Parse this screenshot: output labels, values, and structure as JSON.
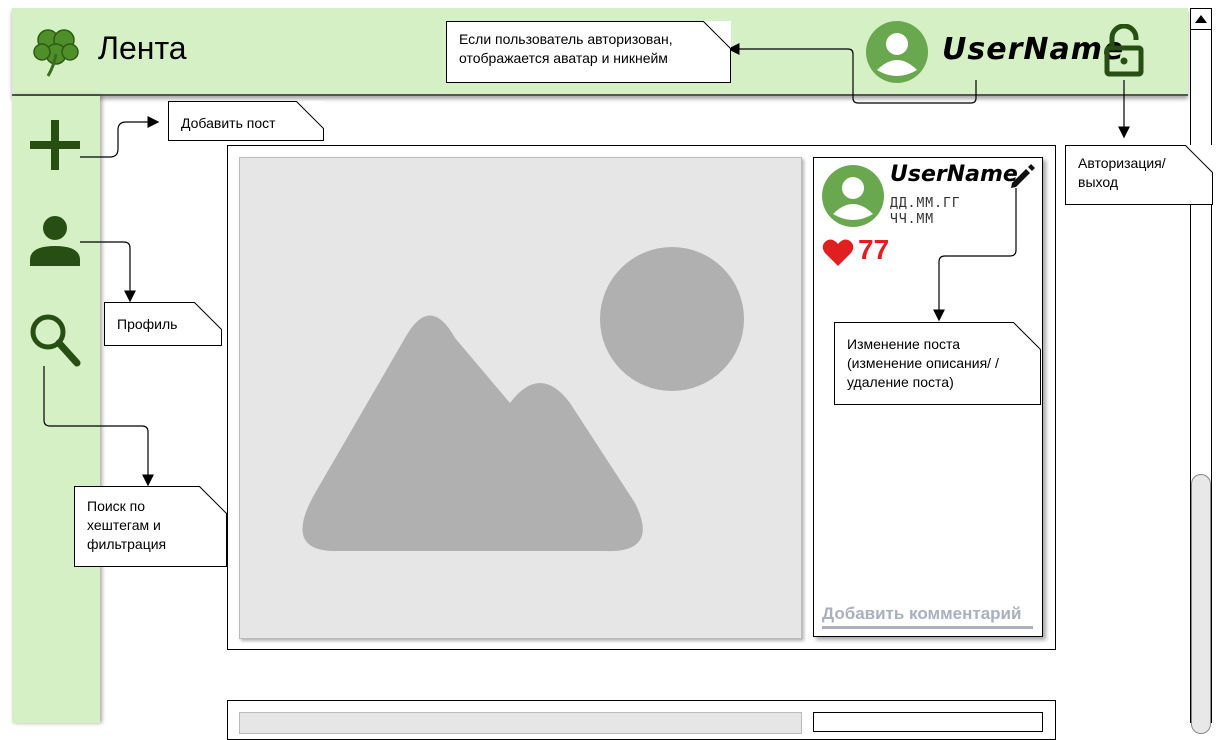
{
  "header": {
    "title": "Лента",
    "username": "UserName"
  },
  "notes": {
    "auth_avatar": "Если пользователь авторизован, отображается аватар и никнейм",
    "add_post": "Добавить пост",
    "login_logout": "Авторизация/ выход",
    "profile": "Профиль",
    "search": "Поиск по хештегам и фильтрация",
    "edit_post": "Изменение поста (изменение описания/ /удаление поста)"
  },
  "post": {
    "username": "UserName",
    "date": "ДД.ММ.ГГ",
    "time": "ЧЧ.ММ",
    "likes": "77",
    "add_comment": "Добавить комментарий"
  },
  "colors": {
    "header_bg": "#d6f0c6",
    "avatar": "#6aa84f",
    "like": "#e02020",
    "icon_dark": "#274e13"
  },
  "icons": [
    "clover-icon",
    "avatar-icon",
    "lock-open-icon",
    "plus-icon",
    "person-icon",
    "search-icon",
    "heart-icon",
    "pencil-icon",
    "image-placeholder-icon"
  ]
}
